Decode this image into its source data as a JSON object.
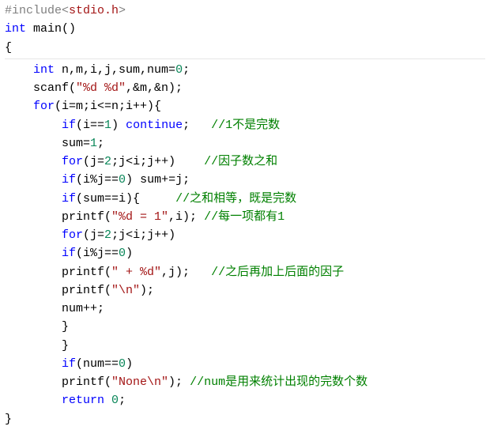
{
  "code": {
    "l01_include_hash": "#include",
    "l01_lt": "<",
    "l01_hdr": "stdio.h",
    "l01_gt": ">",
    "l02_int": "int",
    "l02_main": " main()",
    "l03": "{",
    "l04_int": "int",
    "l04_decl": " n,m,i,j,sum,num=",
    "l04_zero": "0",
    "l04_semi": ";",
    "l05_a": "    scanf(",
    "l05_str": "\"%d %d\"",
    "l05_b": ",&m,&n);",
    "l06_for": "for",
    "l06_body": "(i=m;i<=n;i++){",
    "l07_if": "if",
    "l07_cond": "(i==",
    "l07_one": "1",
    "l07_close": ") ",
    "l07_cont": "continue",
    "l07_semi": ";   ",
    "l07_cmt": "//1不是完数",
    "l08_a": "        sum=",
    "l08_one": "1",
    "l08_semi": ";",
    "l09_for": "for",
    "l09_body": "(j=",
    "l09_two": "2",
    "l09_rest": ";j<i;j++)    ",
    "l09_cmt": "//因子数之和",
    "l10_if": "if",
    "l10_cond": "(i%j==",
    "l10_zero": "0",
    "l10_rest": ") sum+=j;",
    "l11_if": "if",
    "l11_cond": "(sum==i){     ",
    "l11_cmt": "//之和相等，既是完数",
    "l12_a": "        printf(",
    "l12_str": "\"%d = 1\"",
    "l12_b": ",i); ",
    "l12_cmt": "//每一项都有1",
    "l13_for": "for",
    "l13_body": "(j=",
    "l13_two": "2",
    "l13_rest": ";j<i;j++)",
    "l14_if": "if",
    "l14_cond": "(i%j==",
    "l14_zero": "0",
    "l14_close": ")",
    "l15_a": "        printf(",
    "l15_str": "\" + %d\"",
    "l15_b": ",j);   ",
    "l15_cmt": "//之后再加上后面的因子",
    "l16_a": "        printf(",
    "l16_str": "\"\\n\"",
    "l16_b": ");",
    "l17": "        num++;",
    "l18": "        }",
    "l19": "        }",
    "l20_if": "if",
    "l20_cond": "(num==",
    "l20_zero": "0",
    "l20_close": ")",
    "l21_a": "        printf(",
    "l21_str": "\"None\\n\"",
    "l21_b": "); ",
    "l21_cmt": "//num是用来统计出现的完数个数",
    "l22_ret": "return",
    "l22_sp": " ",
    "l22_zero": "0",
    "l22_semi": ";",
    "l23": "}"
  }
}
